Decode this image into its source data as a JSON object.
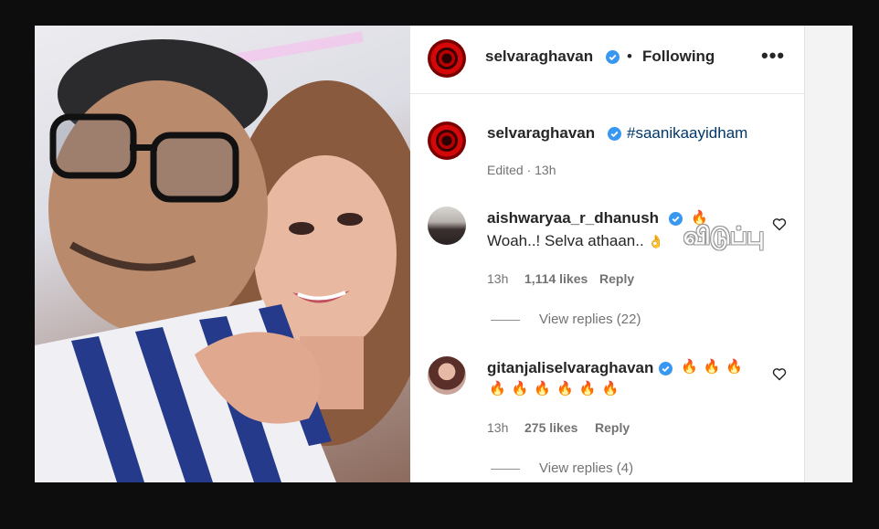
{
  "post": {
    "author": "selvaraghavan",
    "follow_separator": "•",
    "follow_status": "Following",
    "more_glyph": "•••",
    "caption_author": "selvaraghavan",
    "caption_text": "#saanikaayidham",
    "caption_meta": "Edited · 13h"
  },
  "comments": [
    {
      "user": "aishwaryaa_r_dhanush",
      "text": "Woah..! Selva athaan..",
      "time": "13h",
      "likes": "1,114 likes",
      "reply": "Reply",
      "view_replies": "View replies (22)"
    },
    {
      "user": "gitanjaliselvaraghavan",
      "time": "13h",
      "likes": "275 likes",
      "reply": "Reply",
      "view_replies": "View replies (4)"
    }
  ],
  "watermark": "விடுப்பு",
  "colors": {
    "verified": "#3897f0",
    "accent": "#00376b",
    "fire": "#f4511e"
  }
}
